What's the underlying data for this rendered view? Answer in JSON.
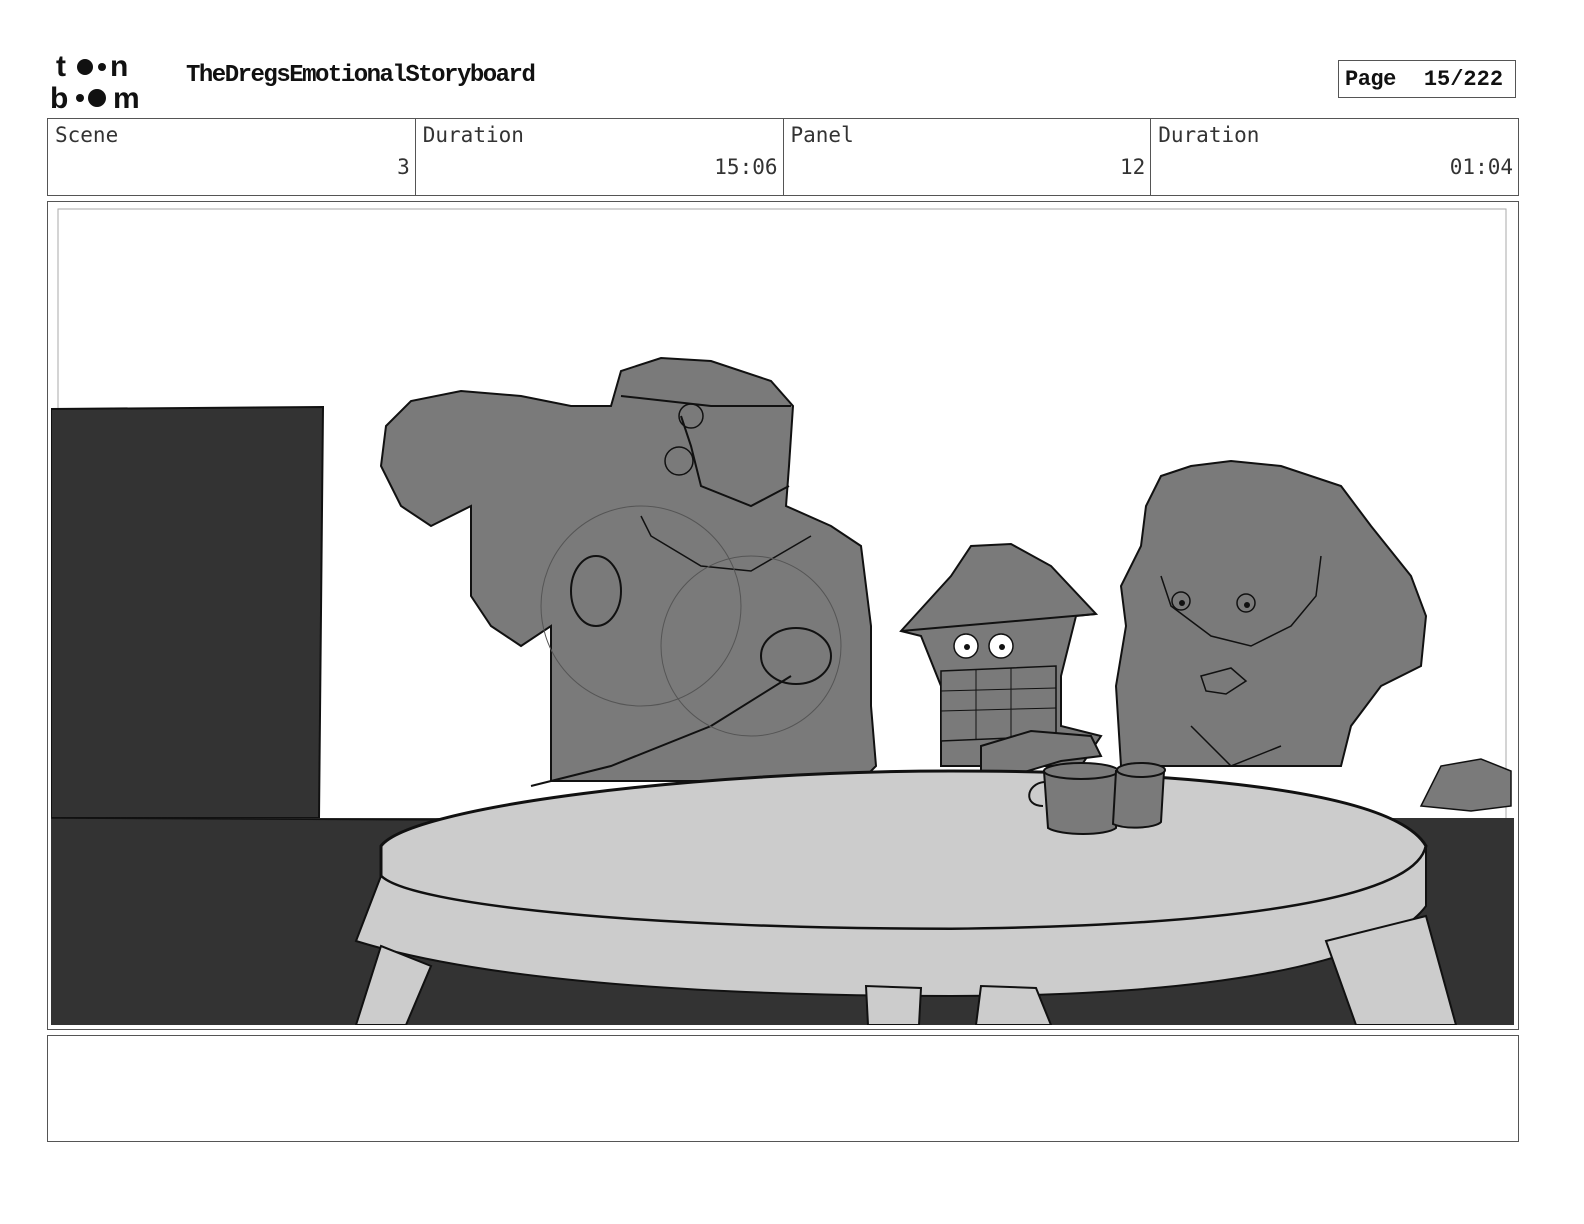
{
  "header": {
    "logo_text": "toon boom",
    "project_title": "TheDregsEmotionalStoryboard",
    "page_label": "Page",
    "page_value": "15/222"
  },
  "info": [
    {
      "label": "Scene",
      "value": "3"
    },
    {
      "label": "Duration",
      "value": "15:06"
    },
    {
      "label": "Panel",
      "value": "12"
    },
    {
      "label": "Duration",
      "value": "01:04"
    }
  ],
  "panel": {
    "image_alt": "Storyboard sketch: three characters seated behind a round table with cups",
    "colors": {
      "background_dark": "#333333",
      "figure_gray": "#7a7a7a",
      "table_light": "#cccccc",
      "line": "#111111"
    }
  },
  "notes": {
    "text": ""
  }
}
